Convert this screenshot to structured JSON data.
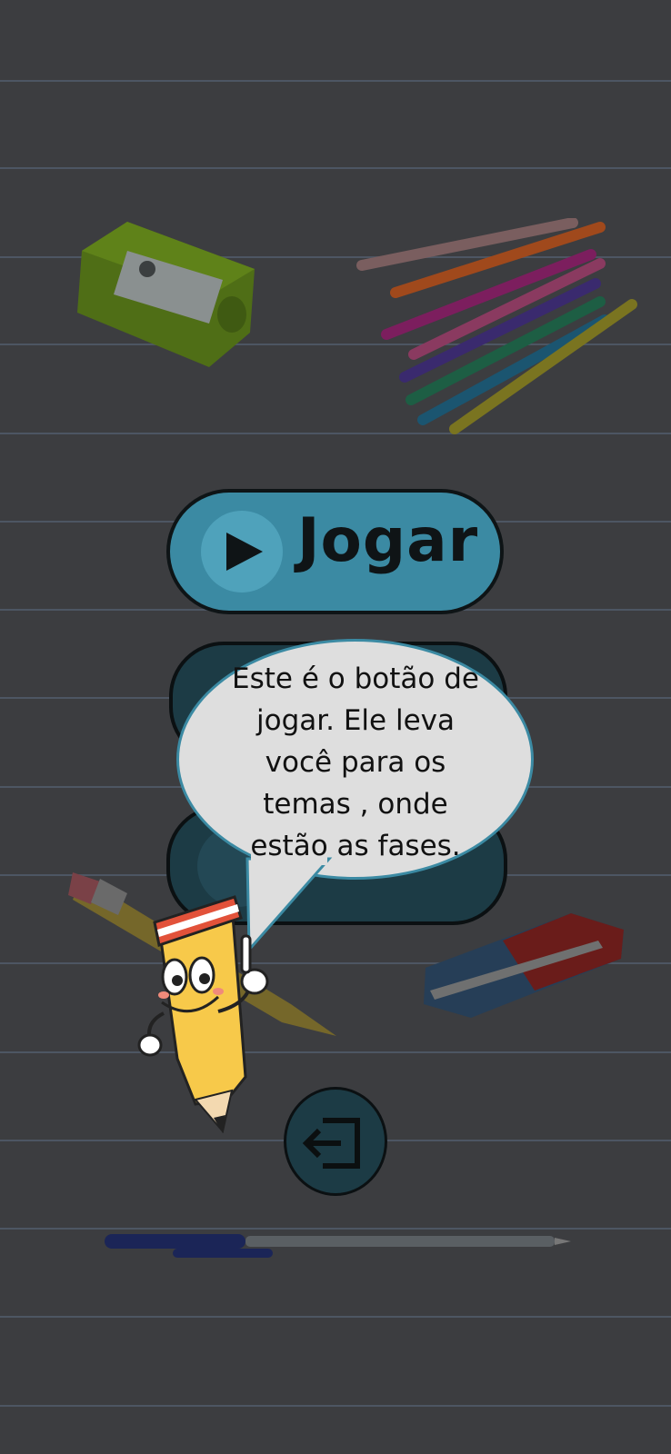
{
  "main": {
    "play_button": {
      "label": "Jogar"
    }
  },
  "tutorial": {
    "bubble_text": "Este é o botão de jogar. Ele leva você para os temas , onde estão as fases."
  },
  "icons": {
    "play": "play-icon",
    "exit": "exit-icon"
  },
  "colors": {
    "background": "#3c3d40",
    "play_button": "#3b8aa3",
    "bubble": "#dedede",
    "bubble_border": "#3b8aa3"
  }
}
